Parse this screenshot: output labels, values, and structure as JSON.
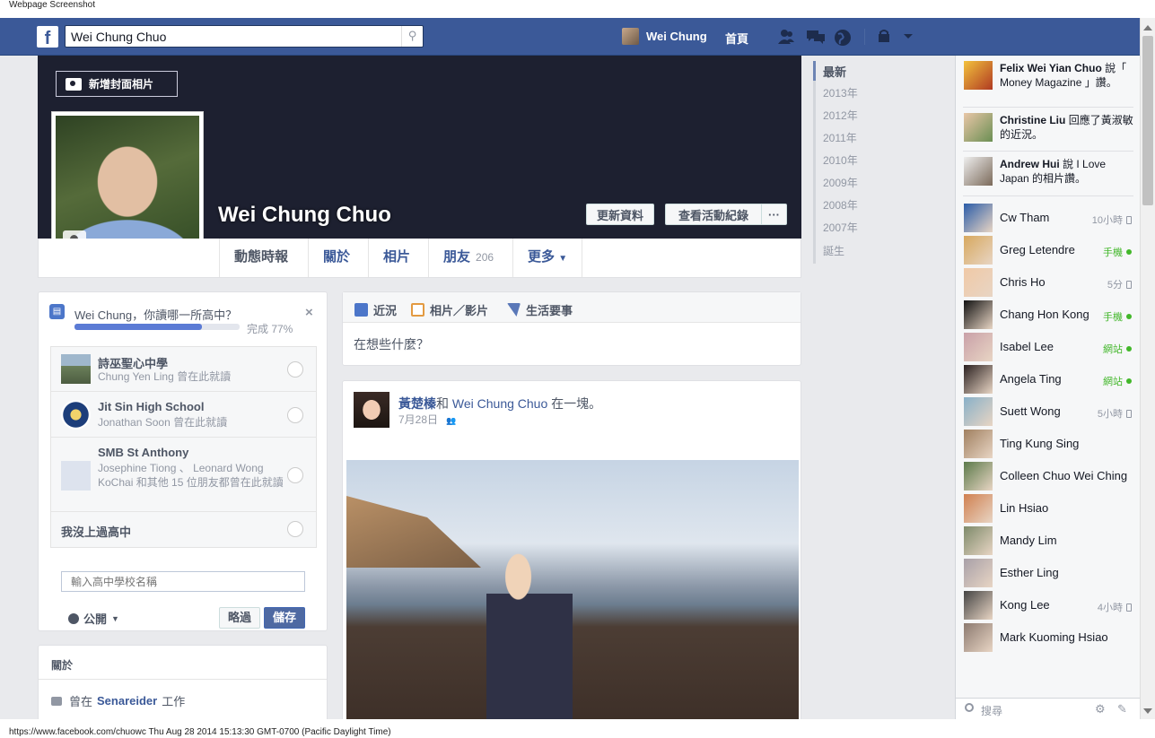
{
  "caption": "Webpage Screenshot",
  "footer": "https://www.facebook.com/chuowc Thu Aug 28 2014 15:13:30 GMT-0700 (Pacific Daylight Time)",
  "topbar": {
    "logo": "f",
    "search_value": "Wei Chung Chuo",
    "user_name": "Wei Chung",
    "home": "首頁"
  },
  "cover": {
    "add_cover": "新增封面相片",
    "name": "Wei Chung Chuo",
    "update_info": "更新資料",
    "activity_log": "查看活動紀錄",
    "more": "···"
  },
  "tabs": [
    {
      "label": "動態時報"
    },
    {
      "label": "關於"
    },
    {
      "label": "相片"
    },
    {
      "label": "朋友",
      "count": "206"
    },
    {
      "label": "更多"
    }
  ],
  "highschool": {
    "question": "Wei Chung，你讀哪一所高中？",
    "progress_pct": 77,
    "progress_text": "完成 77%",
    "schools": [
      {
        "name": "詩巫聖心中學",
        "sub": "Chung Yen Ling 曾在此就讀"
      },
      {
        "name": "Jit Sin High School",
        "sub": "Jonathan Soon 曾在此就讀"
      },
      {
        "name": "SMB St Anthony",
        "sub": "Josephine Tiong 、 Leonard Wong KoChai 和其他 15 位朋友都曾在此就讀"
      }
    ],
    "none": "我沒上過高中",
    "input_placeholder": "輸入高中學校名稱",
    "privacy": "公開",
    "skip": "略過",
    "save": "儲存"
  },
  "about": {
    "title": "關於",
    "work_prefix": "曾在",
    "work_place": "Senareider",
    "work_suffix": "工作"
  },
  "composer": {
    "tabs": [
      "近況",
      "相片／影片",
      "生活要事"
    ],
    "placeholder": "在想些什麼？"
  },
  "story": {
    "author": "黃楚榛",
    "mid": "和",
    "tagged": "Wei Chung Chuo",
    "action": "在一塊。",
    "date": "7月28日"
  },
  "timeline_nav": [
    "最新",
    "2013年",
    "2012年",
    "2011年",
    "2010年",
    "2009年",
    "2008年",
    "2007年",
    "誕生"
  ],
  "ticker": [
    {
      "name": "Felix Wei Yian Chuo",
      "text": "說「 Money Magazine 」讚。"
    },
    {
      "name": "Christine Liu",
      "text": "回應了黃淑敏的近況。"
    },
    {
      "name": "Andrew Hui",
      "text": "說 I Love Japan 的相片讚。"
    }
  ],
  "buddies": [
    {
      "name": "Cw Tham",
      "status": "10小時",
      "kind": "device"
    },
    {
      "name": "Greg Letendre",
      "status": "手機",
      "kind": "green"
    },
    {
      "name": "Chris Ho",
      "status": "5分",
      "kind": "device"
    },
    {
      "name": "Chang Hon Kong",
      "status": "手機",
      "kind": "green"
    },
    {
      "name": "Isabel Lee",
      "status": "網站",
      "kind": "green"
    },
    {
      "name": "Angela Ting",
      "status": "網站",
      "kind": "green"
    },
    {
      "name": "Suett Wong",
      "status": "5小時",
      "kind": "device"
    },
    {
      "name": "Ting Kung Sing",
      "status": "",
      "kind": "none"
    },
    {
      "name": "Colleen Chuo Wei Ching",
      "status": "",
      "kind": "none"
    },
    {
      "name": "Lin Hsiao",
      "status": "",
      "kind": "none"
    },
    {
      "name": "Mandy Lim",
      "status": "",
      "kind": "none"
    },
    {
      "name": "Esther Ling",
      "status": "",
      "kind": "none"
    },
    {
      "name": "Kong Lee",
      "status": "4小時",
      "kind": "device"
    },
    {
      "name": "Mark Kuoming Hsiao",
      "status": "",
      "kind": "none"
    }
  ],
  "chat_search": "搜尋",
  "colors": {
    "brand": "#3b5998",
    "online": "#42b72a"
  }
}
